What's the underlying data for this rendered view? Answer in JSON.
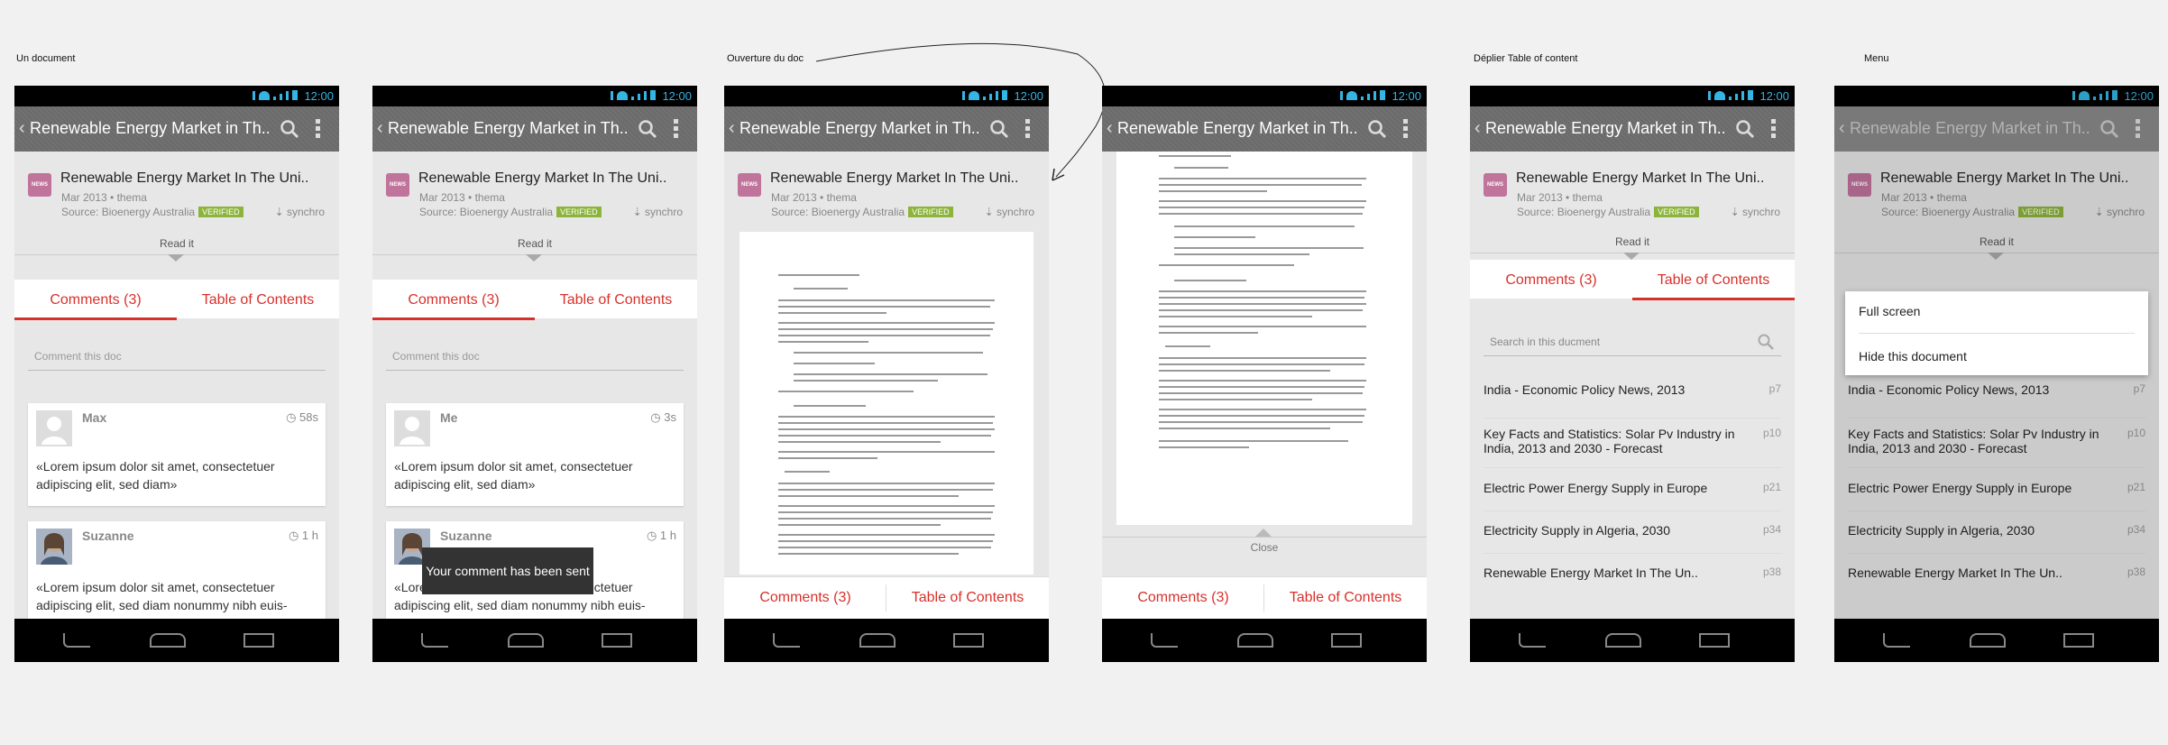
{
  "captions": [
    "Un document",
    "Ouverture du doc",
    "Déplier Table of content",
    "Menu"
  ],
  "status_time": "12:00",
  "action_title": "Renewable Energy Market in Th..",
  "doc": {
    "badge": "NEWS",
    "title": "Renewable Energy Market In The Uni..",
    "meta": "Mar 2013 • thema",
    "source": "Source: Bioenergy Australia",
    "verified": "VERIFIED",
    "synchro": "synchro"
  },
  "read_it": "Read it",
  "tabs": {
    "comments": "Comments (3)",
    "toc": "Table of Contents"
  },
  "comment_placeholder": "Comment this doc",
  "screen1_comments": [
    {
      "name": "Max",
      "time": "58s",
      "text": "«Lorem ipsum dolor sit amet, consectetuer adipiscing elit, sed diam»"
    },
    {
      "name": "Suzanne",
      "time": "1 h",
      "text": "«Lorem ipsum dolor sit amet, consectetuer adipiscing elit, sed diam nonummy nibh euis-"
    }
  ],
  "screen2_comments": [
    {
      "name": "Me",
      "time": "3s",
      "text": "«Lorem ipsum dolor sit amet, consectetuer adipiscing elit, sed diam»"
    },
    {
      "name": "Suzanne",
      "time": "1 h",
      "text": "«Lorem ipsum dolor sit amet, consectetuer adipiscing elit, sed diam nonummy nibh euis-"
    }
  ],
  "toast": "Your comment has been sent",
  "close_label": "Close",
  "toc_search_placeholder": "Search in this ducment",
  "toc_items": [
    {
      "title": "India - Economic Policy News, 2013",
      "page": "p7"
    },
    {
      "title": " Key Facts and Statistics: Solar Pv Industry in India, 2013 and 2030 - Forecast",
      "page": "p10"
    },
    {
      "title": "Electric Power Energy Supply in Europe",
      "page": "p21"
    },
    {
      "title": "Electricity Supply in Algeria, 2030",
      "page": "p34"
    },
    {
      "title": "Renewable Energy Market In The Un..",
      "page": "p38"
    }
  ],
  "menu": {
    "full_screen": "Full screen",
    "hide": "Hide this document"
  },
  "colors": {
    "accent": "#d8302b",
    "statusbar": "#000000",
    "actionbar": "#6b6b6b",
    "verified": "#8cb43c",
    "news_badge": "#c0749c",
    "status_icons": "#33b5e5"
  }
}
